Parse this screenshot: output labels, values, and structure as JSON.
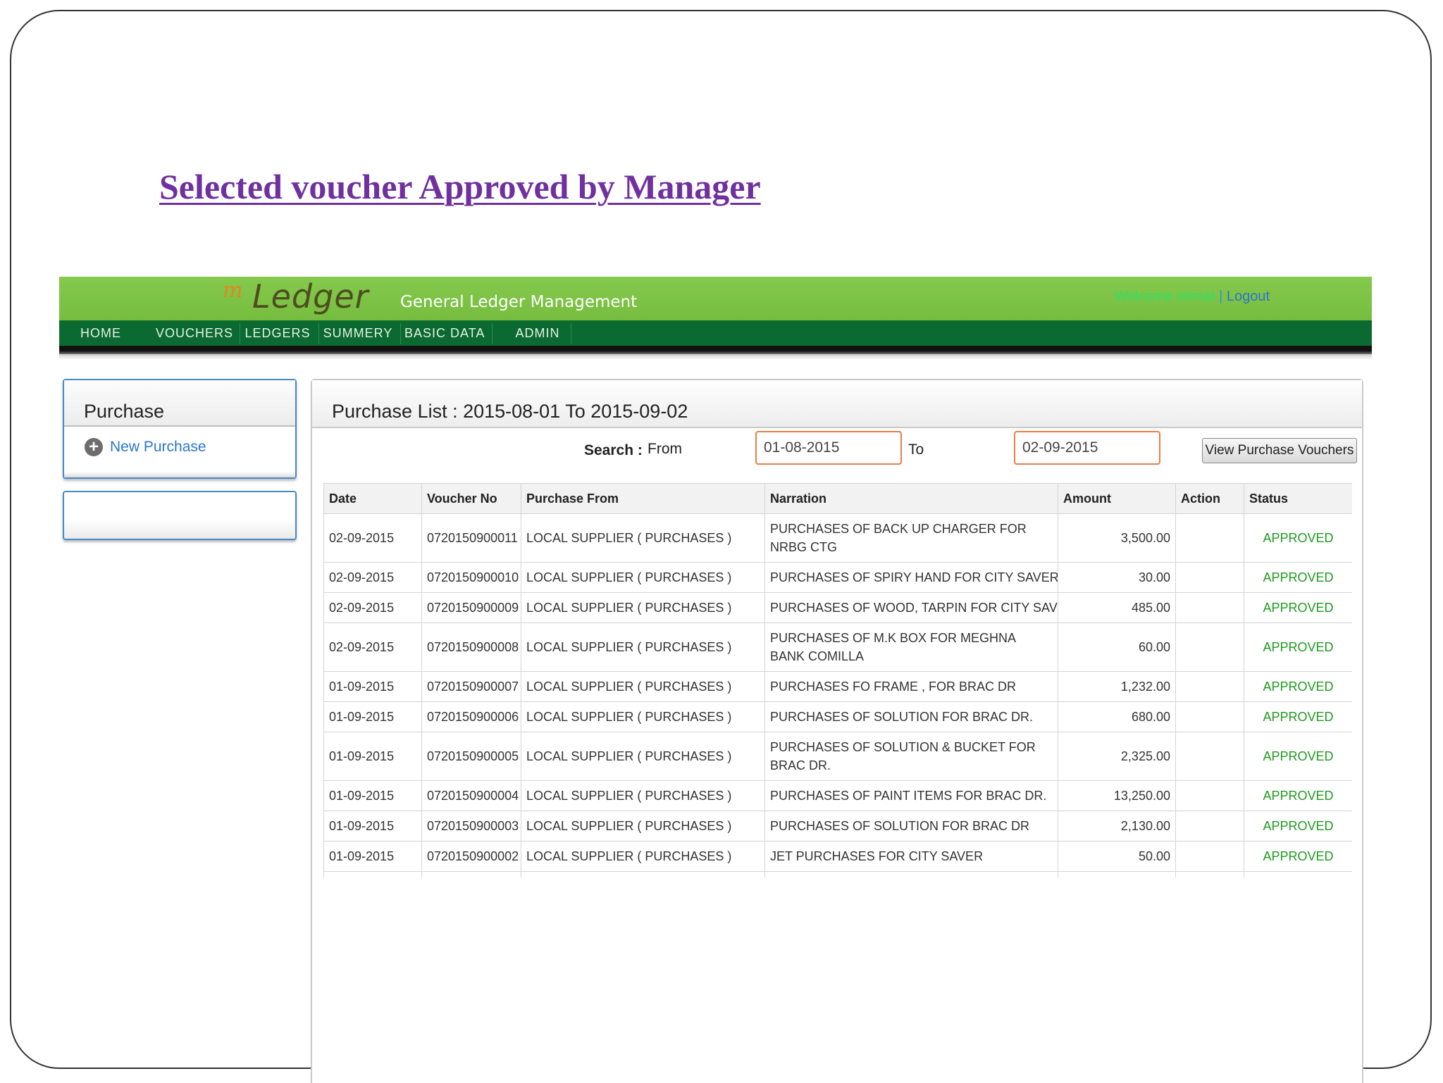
{
  "slide": {
    "title": "Selected voucher Approved by Manager"
  },
  "header": {
    "logo_m": "m",
    "logo_ledger": "Ledger",
    "logo_subtitle": "General Ledger Management",
    "welcome": "Welcome nirmal",
    "separator": "|",
    "logout": "Logout"
  },
  "nav": {
    "items": [
      {
        "label": "HOME"
      },
      {
        "label": "VOUCHERS"
      },
      {
        "label": "LEDGERS"
      },
      {
        "label": "SUMMERY"
      },
      {
        "label": "BASIC DATA"
      },
      {
        "label": "ADMIN"
      }
    ]
  },
  "sidebar": {
    "title": "Purchase",
    "new_purchase": "New Purchase"
  },
  "main": {
    "title": "Purchase List : 2015-08-01 To 2015-09-02",
    "search_label": "Search :",
    "from_label": "From",
    "from_value": "01-08-2015",
    "to_label": "To",
    "to_value": "02-09-2015",
    "view_button": "View Purchase Vouchers"
  },
  "table": {
    "columns": [
      "Date",
      "Voucher No",
      "Purchase From",
      "Narration",
      "Amount",
      "Action",
      "Status"
    ],
    "rows": [
      {
        "date": "02-09-2015",
        "voucher": "0720150900011",
        "from": "LOCAL SUPPLIER ( PURCHASES )",
        "narration": "PURCHASES OF BACK UP CHARGER FOR NRBG CTG",
        "amount": "3,500.00",
        "action": "",
        "status": "APPROVED"
      },
      {
        "date": "02-09-2015",
        "voucher": "0720150900010",
        "from": "LOCAL SUPPLIER ( PURCHASES )",
        "narration": "PURCHASES OF SPIRY HAND FOR CITY SAVER",
        "amount": "30.00",
        "action": "",
        "status": "APPROVED"
      },
      {
        "date": "02-09-2015",
        "voucher": "0720150900009",
        "from": "LOCAL SUPPLIER ( PURCHASES )",
        "narration": "PURCHASES OF WOOD, TARPIN FOR CITY SAVER.",
        "amount": "485.00",
        "action": "",
        "status": "APPROVED"
      },
      {
        "date": "02-09-2015",
        "voucher": "0720150900008",
        "from": "LOCAL SUPPLIER ( PURCHASES )",
        "narration": "PURCHASES OF M.K BOX FOR MEGHNA BANK COMILLA",
        "amount": "60.00",
        "action": "",
        "status": "APPROVED"
      },
      {
        "date": "01-09-2015",
        "voucher": "0720150900007",
        "from": "LOCAL SUPPLIER ( PURCHASES )",
        "narration": "PURCHASES FO FRAME , FOR BRAC DR",
        "amount": "1,232.00",
        "action": "",
        "status": "APPROVED"
      },
      {
        "date": "01-09-2015",
        "voucher": "0720150900006",
        "from": "LOCAL SUPPLIER ( PURCHASES )",
        "narration": "PURCHASES OF SOLUTION FOR BRAC DR.",
        "amount": "680.00",
        "action": "",
        "status": "APPROVED"
      },
      {
        "date": "01-09-2015",
        "voucher": "0720150900005",
        "from": "LOCAL SUPPLIER ( PURCHASES )",
        "narration": "PURCHASES OF SOLUTION & BUCKET FOR BRAC DR.",
        "amount": "2,325.00",
        "action": "",
        "status": "APPROVED"
      },
      {
        "date": "01-09-2015",
        "voucher": "0720150900004",
        "from": "LOCAL SUPPLIER ( PURCHASES )",
        "narration": "PURCHASES OF PAINT ITEMS FOR BRAC DR.",
        "amount": "13,250.00",
        "action": "",
        "status": "APPROVED"
      },
      {
        "date": "01-09-2015",
        "voucher": "0720150900003",
        "from": "LOCAL SUPPLIER ( PURCHASES )",
        "narration": "PURCHASES OF SOLUTION FOR BRAC DR",
        "amount": "2,130.00",
        "action": "",
        "status": "APPROVED"
      },
      {
        "date": "01-09-2015",
        "voucher": "0720150900002",
        "from": "LOCAL SUPPLIER ( PURCHASES )",
        "narration": "JET PURCHASES FOR CITY SAVER",
        "amount": "50.00",
        "action": "",
        "status": "APPROVED"
      }
    ]
  },
  "colors": {
    "title": "#7030a0",
    "header_green": "#7bc143",
    "nav_green": "#0b6a31",
    "approved": "#1e9a1e",
    "input_border": "#e67e4a",
    "link": "#2a76c9"
  }
}
